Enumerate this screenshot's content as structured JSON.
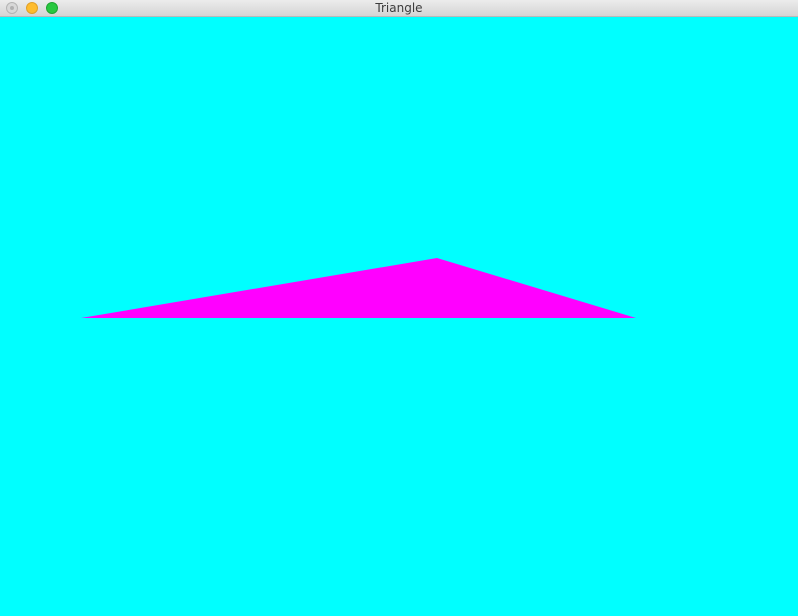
{
  "window": {
    "title": "Triangle"
  },
  "titlebar": {
    "buttons": [
      "close",
      "minimize",
      "zoom"
    ]
  },
  "scene": {
    "background_color": "#00FFFF",
    "shape": "triangle",
    "fill_color": "#FF00FF"
  }
}
